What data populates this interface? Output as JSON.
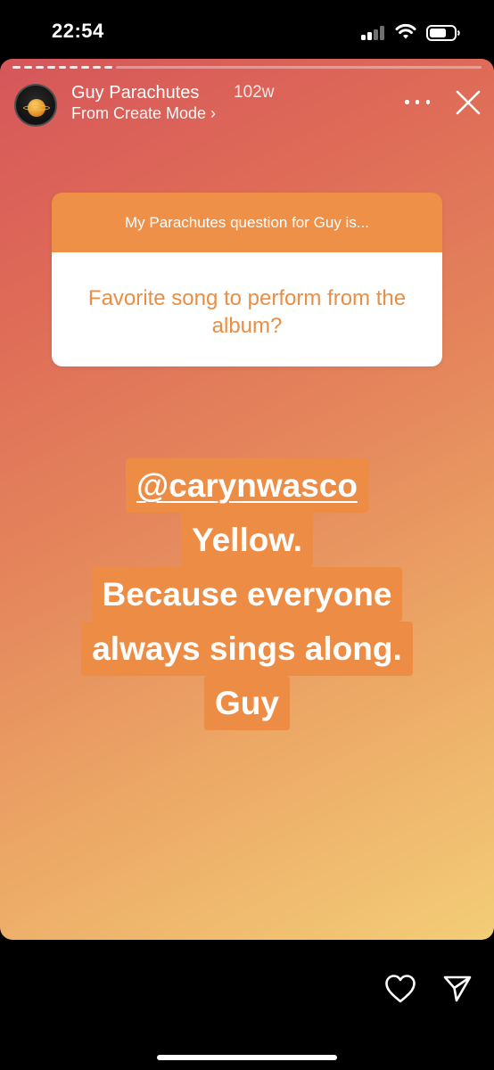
{
  "status_bar": {
    "time": "22:54"
  },
  "story": {
    "user": {
      "name": "Guy Parachutes",
      "age": "102w",
      "source": "From Create Mode ›"
    },
    "question": {
      "prompt": "My Parachutes question for Guy is...",
      "text": "Favorite song to perform from the album?"
    },
    "answer": {
      "mention": "@carynwasco",
      "lines": [
        "Yellow.",
        "Because everyone",
        "always sings along.",
        "Guy"
      ]
    }
  },
  "icons": {
    "more": "more-icon",
    "close": "close-icon",
    "heart": "heart-icon",
    "send": "send-icon"
  },
  "colors": {
    "accent": "#ef9048",
    "question_text": "#e98e43"
  }
}
